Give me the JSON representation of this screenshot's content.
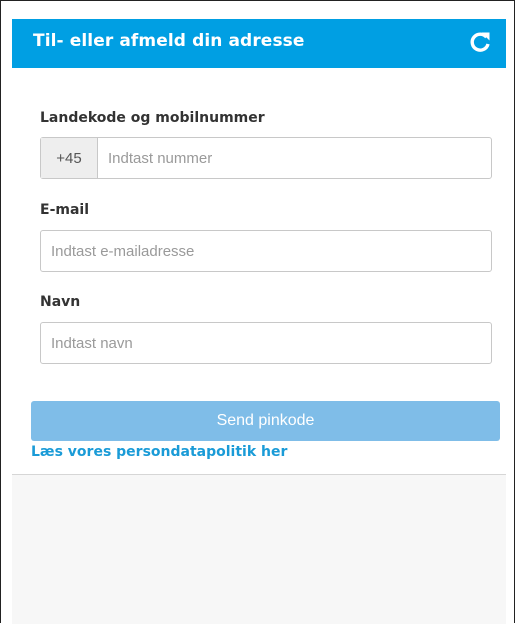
{
  "header": {
    "title": "Til- eller afmeld din adresse",
    "refresh_icon": "refresh-icon",
    "background_color": "#009fe3"
  },
  "form": {
    "phone": {
      "label": "Landekode og mobilnummer",
      "country_code": "+45",
      "placeholder": "Indtast nummer",
      "value": ""
    },
    "email": {
      "label": "E-mail",
      "placeholder": "Indtast e-mailadresse",
      "value": ""
    },
    "name": {
      "label": "Navn",
      "placeholder": "Indtast navn",
      "value": ""
    },
    "submit_label": "Send pinkode",
    "submit_color": "#7fbde8"
  },
  "links": {
    "privacy_policy": "Læs vores persondatapolitik her",
    "link_color": "#1a9bd7"
  }
}
